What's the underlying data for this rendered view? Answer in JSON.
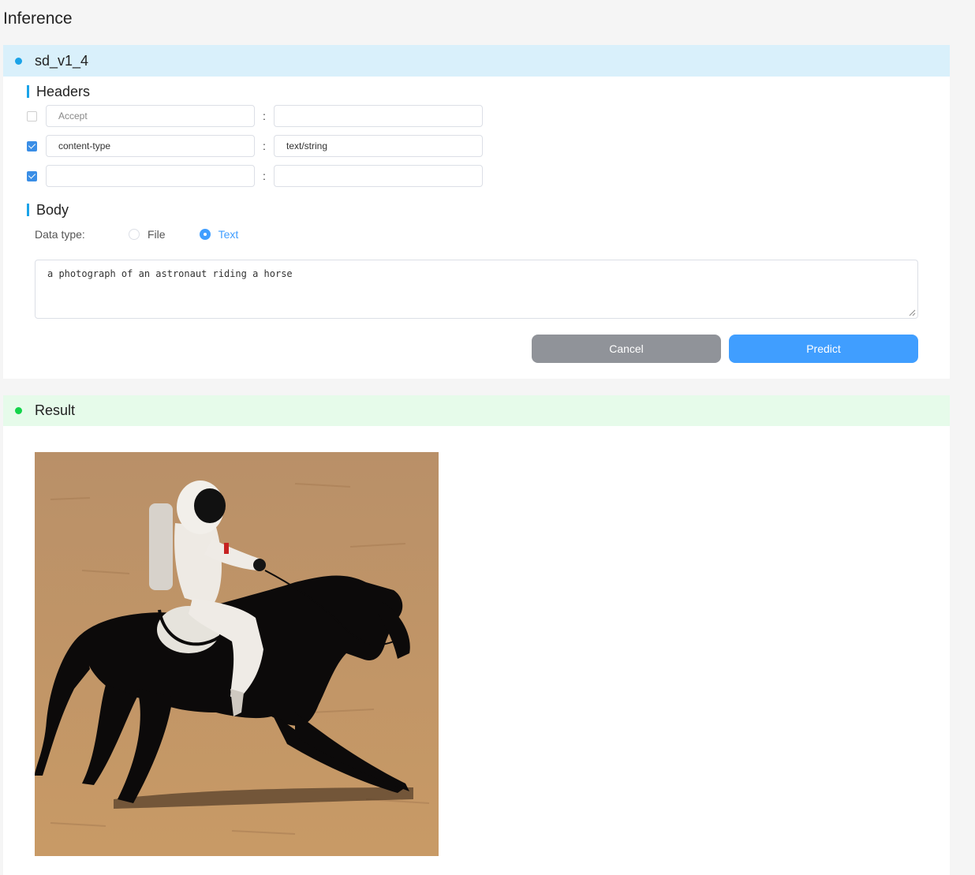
{
  "page": {
    "title": "Inference"
  },
  "model": {
    "name": "sd_v1_4"
  },
  "headers": {
    "title": "Headers",
    "rows": [
      {
        "checked": false,
        "key": "Accept",
        "value": ""
      },
      {
        "checked": true,
        "key": "content-type",
        "value": "text/string"
      },
      {
        "checked": true,
        "key": "",
        "value": ""
      }
    ],
    "separator": ":"
  },
  "body": {
    "title": "Body",
    "data_type_label": "Data type:",
    "options": [
      "File",
      "Text"
    ],
    "selected": "Text",
    "text": "a photograph of an astronaut riding a horse"
  },
  "actions": {
    "cancel": "Cancel",
    "predict": "Predict"
  },
  "result": {
    "title": "Result"
  },
  "colors": {
    "primary": "#409eff",
    "cancel": "#909399",
    "header_blue": "#d9f0fb",
    "header_green": "#e6fbea"
  }
}
